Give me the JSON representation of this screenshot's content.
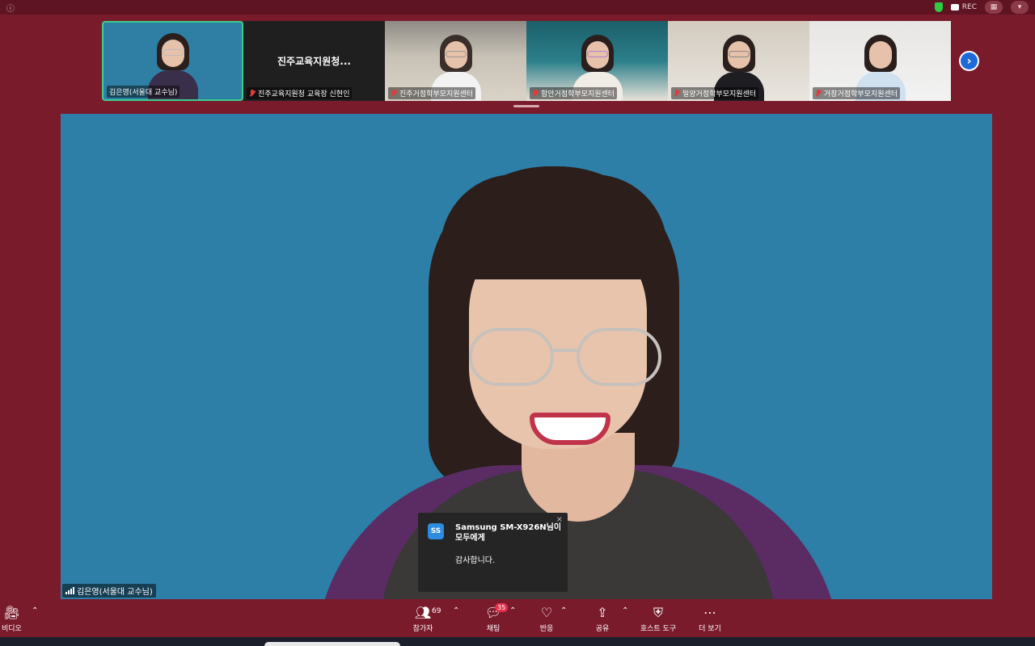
{
  "titlebar": {
    "left_text": "",
    "rec_label": "REC"
  },
  "gallery": {
    "tiles": [
      {
        "label": "김은영(서울대 교수님)",
        "video": true,
        "muted": false,
        "active": true
      },
      {
        "label": "진주교육지원청 교육장 신현인",
        "video": false,
        "display_name": "진주교육지원청...",
        "muted": true
      },
      {
        "label": "진주거점학부모지원센터",
        "video": true,
        "muted": true
      },
      {
        "label": "함안거점학부모지원센터",
        "video": true,
        "muted": true
      },
      {
        "label": "밀양거점학부모지원센터",
        "video": true,
        "muted": true
      },
      {
        "label": "거창거점학부모지원센터",
        "video": true,
        "muted": true
      }
    ],
    "next_icon": "chevron-right-icon"
  },
  "speaker": {
    "label": "김은영(서울대 교수님)"
  },
  "chat_popup": {
    "avatar_initials": "SS",
    "sender": "Samsung SM-X926N님이 모두에게",
    "message": "감사합니다.",
    "close_symbol": "×"
  },
  "toolbar": {
    "video_label": "비디오",
    "participants_label": "참가자",
    "participants_count": "69",
    "chat_label": "채팅",
    "chat_badge": "35",
    "reactions_label": "반응",
    "share_label": "공유",
    "host_tools_label": "호스트 도구",
    "more_label": "더 보기"
  },
  "colors": {
    "background": "#7a1b2c",
    "speaker_bg": "#2e7fa8",
    "active_border": "#3ccf8e",
    "badge": "#e5304b",
    "next_button": "#1e6ad8"
  }
}
